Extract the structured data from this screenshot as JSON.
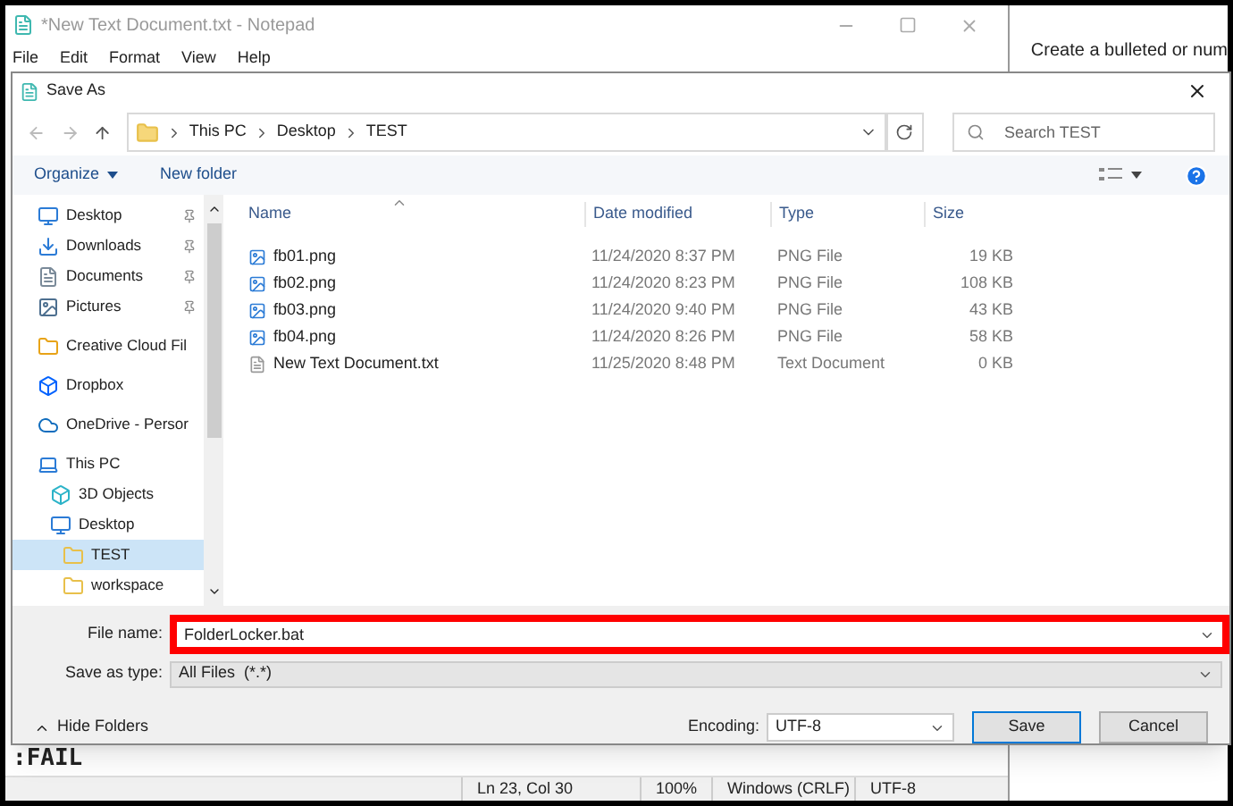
{
  "notepad": {
    "title": "*New Text Document.txt - Notepad",
    "menu": [
      "File",
      "Edit",
      "Format",
      "View",
      "Help"
    ],
    "visible_line": ":FAIL",
    "status_bar": [
      "Ln 23, Col 30",
      "100%",
      "Windows (CRLF)",
      "UTF-8"
    ]
  },
  "side_panel": {
    "text": "Create a bulleted or num"
  },
  "dialog": {
    "title": "Save As",
    "path": [
      "This PC",
      "Desktop",
      "TEST"
    ],
    "search": {
      "placeholder": "Search TEST"
    },
    "toolbar": [
      "Organize",
      "New folder"
    ],
    "sidebar": [
      {
        "label": "Desktop",
        "kind": "desktop",
        "pinned": true,
        "selected": false
      },
      {
        "label": "Downloads",
        "kind": "download",
        "pinned": true,
        "selected": false
      },
      {
        "label": "Documents",
        "kind": "document",
        "pinned": true,
        "selected": false
      },
      {
        "label": "Pictures",
        "kind": "pictures",
        "pinned": true,
        "selected": false
      },
      {
        "label": "Creative Cloud Fil",
        "kind": "cloudfolder",
        "pinned": false,
        "selected": false
      },
      {
        "label": "Dropbox",
        "kind": "dropbox",
        "pinned": false,
        "selected": false
      },
      {
        "label": "OneDrive - Persor",
        "kind": "cloud",
        "pinned": false,
        "selected": false
      },
      {
        "label": "This PC",
        "kind": "pc",
        "pinned": false,
        "selected": false,
        "children": [
          {
            "label": "3D Objects",
            "kind": "cube",
            "pinned": false,
            "selected": false
          },
          {
            "label": "Desktop",
            "kind": "desktop",
            "pinned": false,
            "selected": false,
            "children": [
              {
                "label": "TEST",
                "kind": "folder",
                "pinned": false,
                "selected": true
              },
              {
                "label": "workspace",
                "kind": "folder",
                "pinned": false,
                "selected": false
              }
            ]
          }
        ]
      }
    ],
    "columns": [
      "Name",
      "Date modified",
      "Type",
      "Size"
    ],
    "files": [
      {
        "name": "fb01.png",
        "kind": "image",
        "date": "11/24/2020 8:37 PM",
        "type": "PNG File",
        "size": "19 KB"
      },
      {
        "name": "fb02.png",
        "kind": "image",
        "date": "11/24/2020 8:23 PM",
        "type": "PNG File",
        "size": "108 KB"
      },
      {
        "name": "fb03.png",
        "kind": "image",
        "date": "11/24/2020 9:40 PM",
        "type": "PNG File",
        "size": "43 KB"
      },
      {
        "name": "fb04.png",
        "kind": "image",
        "date": "11/24/2020 8:26 PM",
        "type": "PNG File",
        "size": "58 KB"
      },
      {
        "name": "New Text Document.txt",
        "kind": "text",
        "date": "11/25/2020 8:48 PM",
        "type": "Text Document",
        "size": "0 KB"
      }
    ],
    "file_name": {
      "label": "File name:",
      "value": "FolderLocker.bat",
      "highlighted": true
    },
    "save_as_type": {
      "label": "Save as type:",
      "value": "All Files  (*.*)"
    },
    "hide_folders": "Hide Folders",
    "encoding": {
      "label": "Encoding:",
      "value": "UTF-8"
    },
    "buttons": [
      "Save",
      "Cancel"
    ]
  }
}
